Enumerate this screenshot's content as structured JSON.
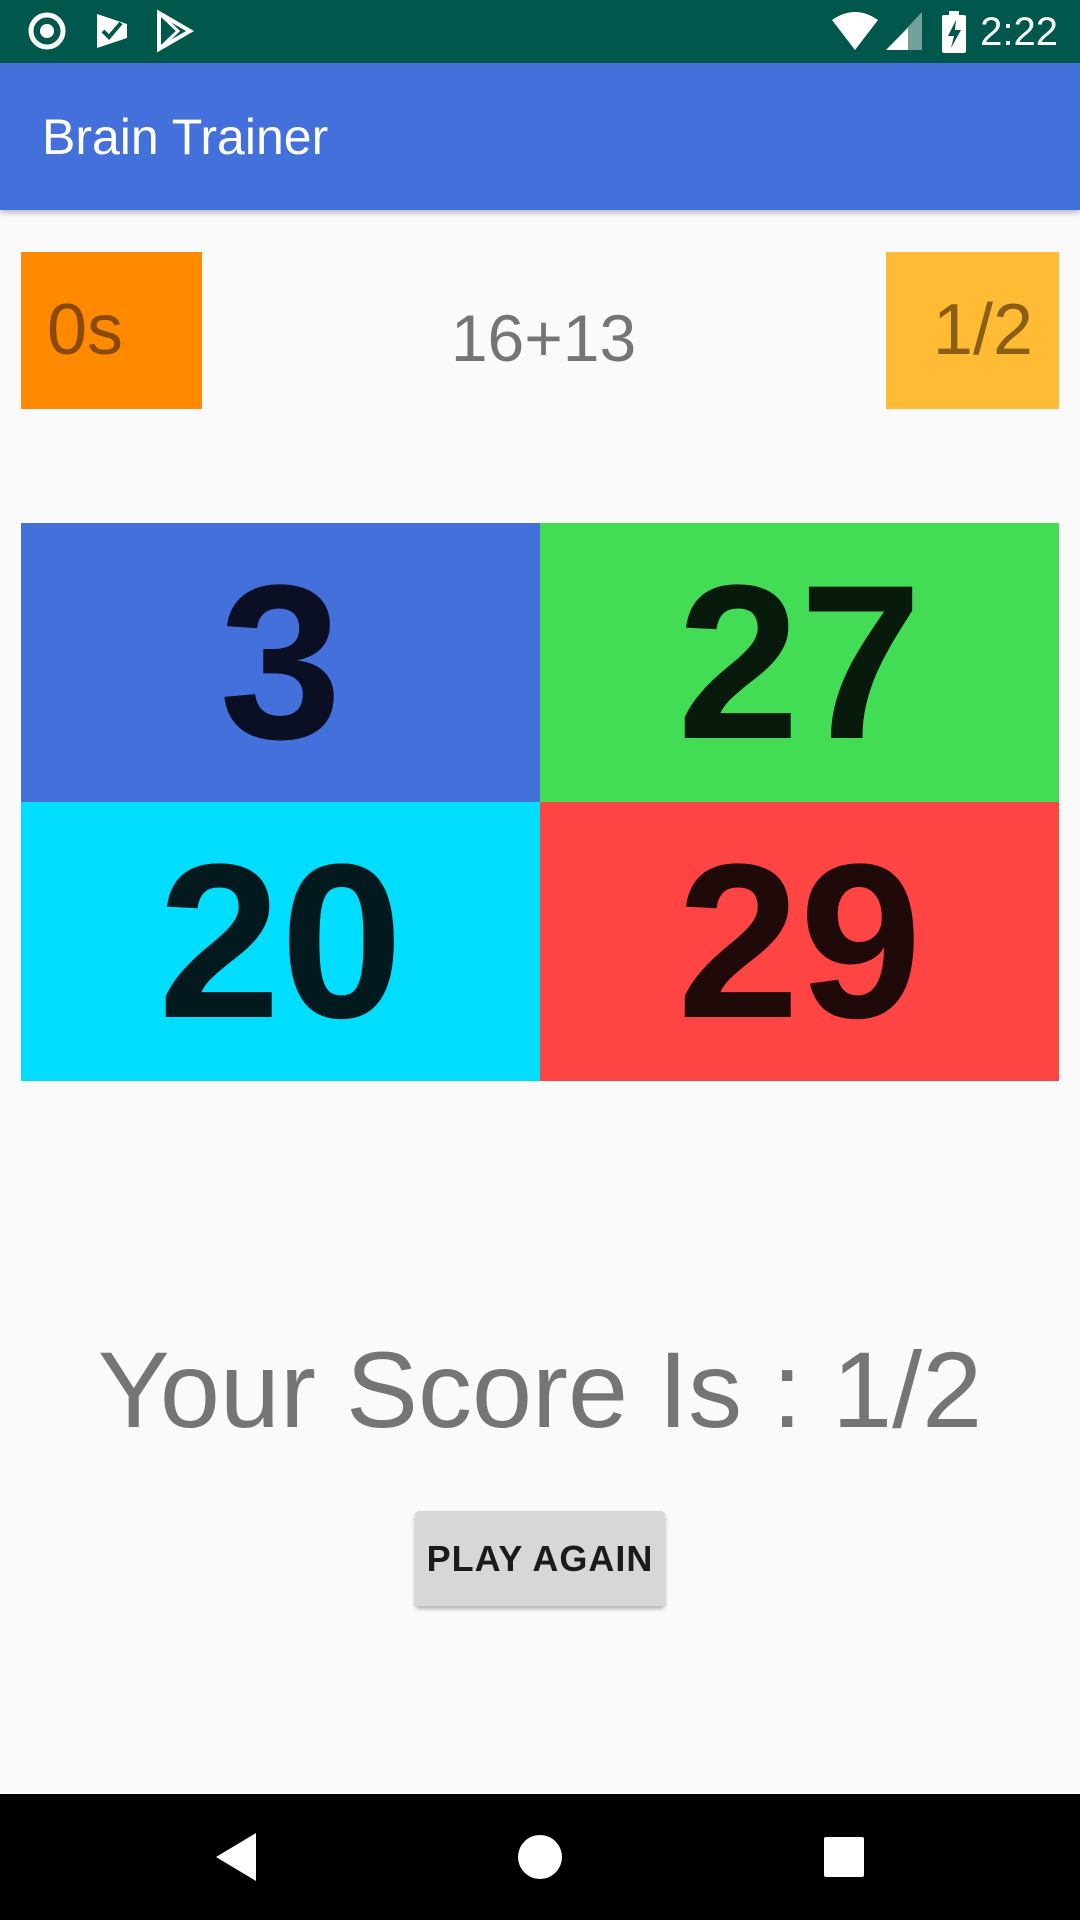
{
  "status_bar": {
    "time": "2:22",
    "left_icons": [
      "record-icon",
      "task-check-icon",
      "play-store-icon"
    ],
    "right_icons": [
      "wifi-icon",
      "cell-signal-icon",
      "battery-charging-icon"
    ]
  },
  "app_bar": {
    "title": "Brain Trainer"
  },
  "game": {
    "timer": "0s",
    "question": "16+13",
    "score": "1/2",
    "answers": [
      {
        "value": "3",
        "color": "#4370db",
        "text_color": "#0a0f24"
      },
      {
        "value": "27",
        "color": "#43dd55",
        "text_color": "#081a0b"
      },
      {
        "value": "20",
        "color": "#00ddff",
        "text_color": "#021a1e"
      },
      {
        "value": "29",
        "color": "#ff4444",
        "text_color": "#200909"
      }
    ],
    "result": "Your Score Is : 1/2",
    "play_again_label": "PLAY AGAIN"
  },
  "colors": {
    "status_bar": "#00574b",
    "app_bar": "#4370db",
    "timer_bg": "#ff8a00",
    "score_bg": "#ffbb33",
    "button_bg": "#d6d7d7"
  },
  "nav_bar": {
    "buttons": [
      "back-icon",
      "home-icon",
      "recents-icon"
    ]
  }
}
